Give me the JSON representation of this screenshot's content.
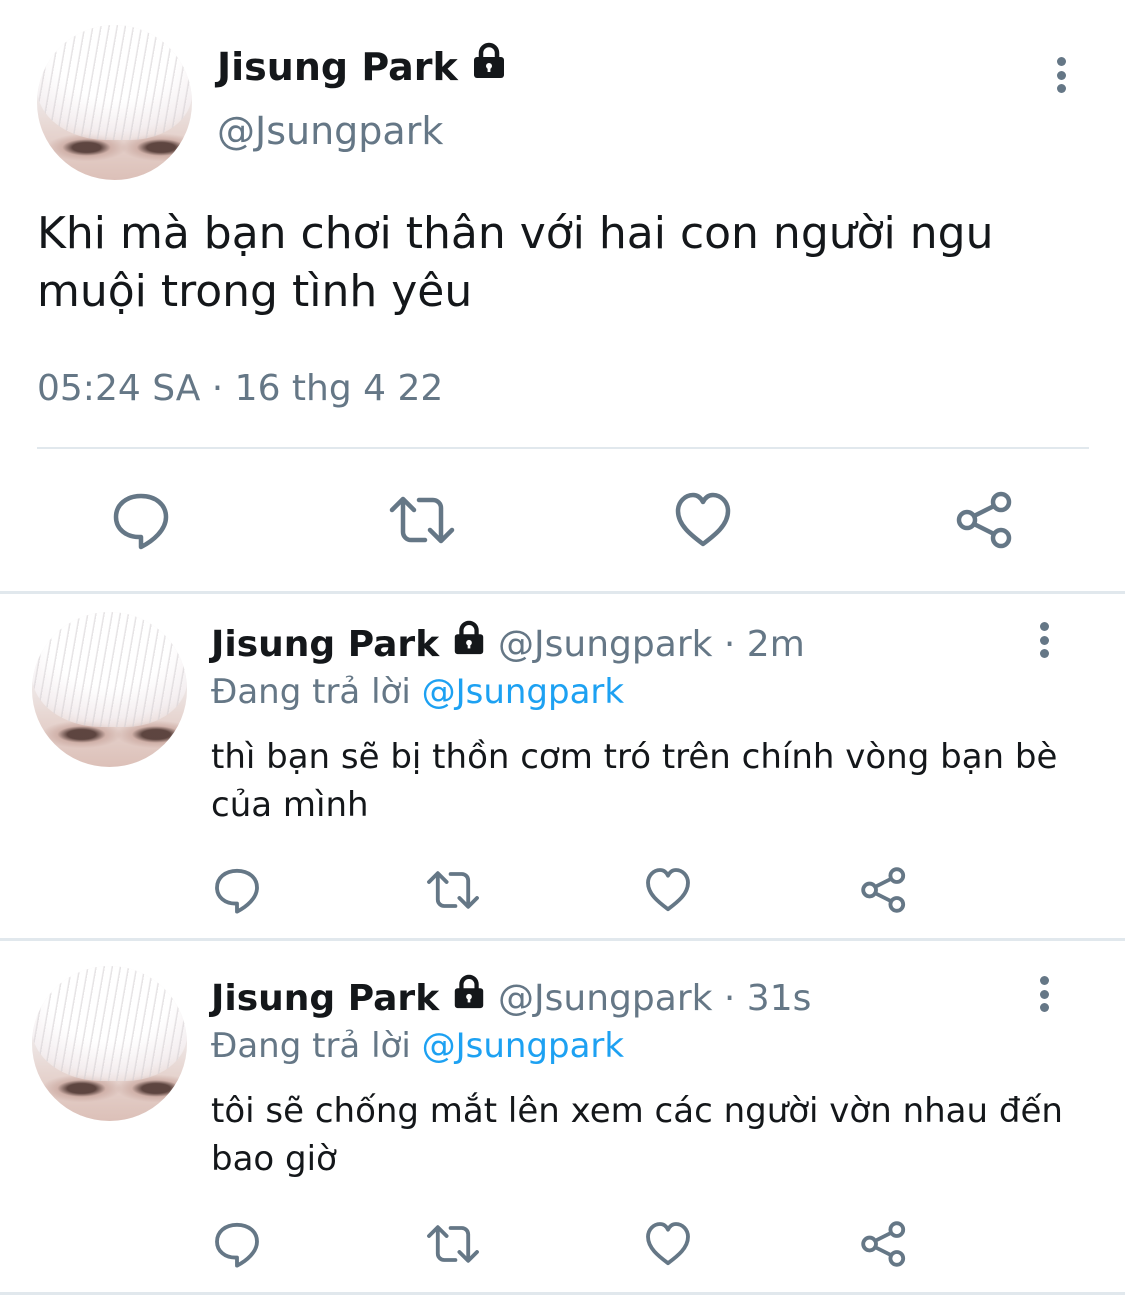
{
  "colors": {
    "text": "#14171a",
    "secondary": "#657786",
    "link": "#1da1f2",
    "divider": "#e1e8ed"
  },
  "main_tweet": {
    "display_name": "Jisung Park",
    "handle": "@Jsungpark",
    "text": "Khi mà bạn chơi thân với hai con người ngu muội trong tình yêu",
    "timestamp": "05:24 SA · 16 thg 4 22",
    "icons": [
      "lock-icon",
      "more-options-icon",
      "reply-icon",
      "retweet-icon",
      "like-icon",
      "share-icon"
    ]
  },
  "replies": [
    {
      "display_name": "Jisung Park",
      "handle_time": "@Jsungpark · 2m",
      "replying_label": "Đang trả lời",
      "replying_to": "@Jsungpark",
      "text": "thì bạn sẽ bị thồn cơm tró trên chính vòng bạn bè của mình"
    },
    {
      "display_name": "Jisung Park",
      "handle_time": "@Jsungpark · 31s",
      "replying_label": "Đang trả lời",
      "replying_to": "@Jsungpark",
      "text": "tôi sẽ chống mắt lên xem các người vờn nhau đến bao giờ"
    }
  ]
}
